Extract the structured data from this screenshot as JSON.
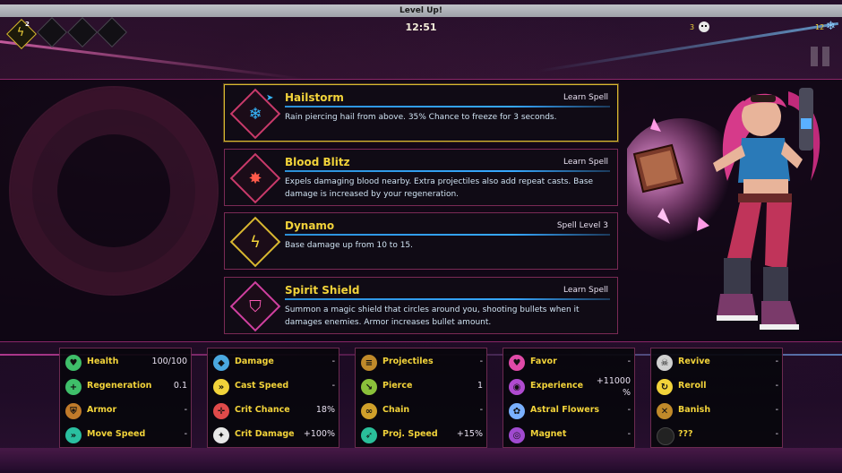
{
  "header": {
    "banner": "Level Up!",
    "timer": "12:51",
    "kill_count": "3",
    "gem_count": "12",
    "weapon_slots": [
      {
        "icon": "lightning-icon",
        "level": "2",
        "active": true
      },
      {
        "icon": "empty-slot",
        "level": "",
        "active": false
      },
      {
        "icon": "empty-slot",
        "level": "",
        "active": false
      },
      {
        "icon": "empty-slot",
        "level": "",
        "active": false
      }
    ]
  },
  "choices": [
    {
      "name": "Hailstorm",
      "kind": "Learn Spell",
      "description": "Rain piercing hail from above. 35% Chance to freeze for 3 seconds.",
      "icon": "snowflake-icon",
      "selected": true,
      "color": "#36b8ff"
    },
    {
      "name": "Blood Blitz",
      "kind": "Learn Spell",
      "description": "Expels damaging blood nearby. Extra projectiles also add repeat casts. Base damage is increased by your regeneration.",
      "icon": "blood-burst-icon",
      "selected": false,
      "color": "#ff5a4a"
    },
    {
      "name": "Dynamo",
      "kind": "Spell Level 3",
      "description": "Base damage up from 10 to 15.",
      "icon": "lightning-icon",
      "selected": false,
      "color": "#f2d33a"
    },
    {
      "name": "Spirit Shield",
      "kind": "Learn Spell",
      "description": "Summon a magic shield that circles around you, shooting bullets when it damages enemies. Armor increases bullet amount.",
      "icon": "shield-icon",
      "selected": false,
      "color": "#ff5ab8"
    }
  ],
  "stats": [
    [
      {
        "label": "Health",
        "value": "100/100",
        "icon": "heart-cross-icon",
        "color": "#3fbf6a"
      },
      {
        "label": "Regeneration",
        "value": "0.1",
        "icon": "plus-icon",
        "color": "#3fbf6a"
      },
      {
        "label": "Armor",
        "value": "-",
        "icon": "armor-icon",
        "color": "#c07a2a"
      },
      {
        "label": "Move Speed",
        "value": "-",
        "icon": "boot-icon",
        "color": "#2abfa0"
      }
    ],
    [
      {
        "label": "Damage",
        "value": "-",
        "icon": "damage-icon",
        "color": "#4aa8e0"
      },
      {
        "label": "Cast Speed",
        "value": "-",
        "icon": "fast-forward-icon",
        "color": "#f2d33a"
      },
      {
        "label": "Crit Chance",
        "value": "18%",
        "icon": "crosshair-icon",
        "color": "#e04a4a"
      },
      {
        "label": "Crit Damage",
        "value": "+100%",
        "icon": "crit-damage-icon",
        "color": "#e8e8e8"
      }
    ],
    [
      {
        "label": "Projectiles",
        "value": "-",
        "icon": "projectiles-icon",
        "color": "#c08a2a"
      },
      {
        "label": "Pierce",
        "value": "1",
        "icon": "pierce-icon",
        "color": "#8ac03a"
      },
      {
        "label": "Chain",
        "value": "-",
        "icon": "chain-icon",
        "color": "#d0a02a"
      },
      {
        "label": "Proj. Speed",
        "value": "+15%",
        "icon": "proj-speed-icon",
        "color": "#2abf9a"
      }
    ],
    [
      {
        "label": "Favor",
        "value": "-",
        "icon": "favor-heart-icon",
        "color": "#e04aa8"
      },
      {
        "label": "Experience",
        "value": "+11000 %",
        "icon": "experience-icon",
        "color": "#b04ad0"
      },
      {
        "label": "Astral Flowers",
        "value": "-",
        "icon": "flower-icon",
        "color": "#7ab0ff"
      },
      {
        "label": "Magnet",
        "value": "-",
        "icon": "magnet-icon",
        "color": "#a04ad0"
      }
    ],
    [
      {
        "label": "Revive",
        "value": "-",
        "icon": "skull-icon",
        "color": "#d0d0d0"
      },
      {
        "label": "Reroll",
        "value": "-",
        "icon": "reroll-icon",
        "color": "#f2d33a"
      },
      {
        "label": "Banish",
        "value": "-",
        "icon": "banish-icon",
        "color": "#c08a2a"
      },
      {
        "label": "???",
        "value": "-",
        "icon": "locked-icon",
        "color": "#333333"
      }
    ]
  ]
}
